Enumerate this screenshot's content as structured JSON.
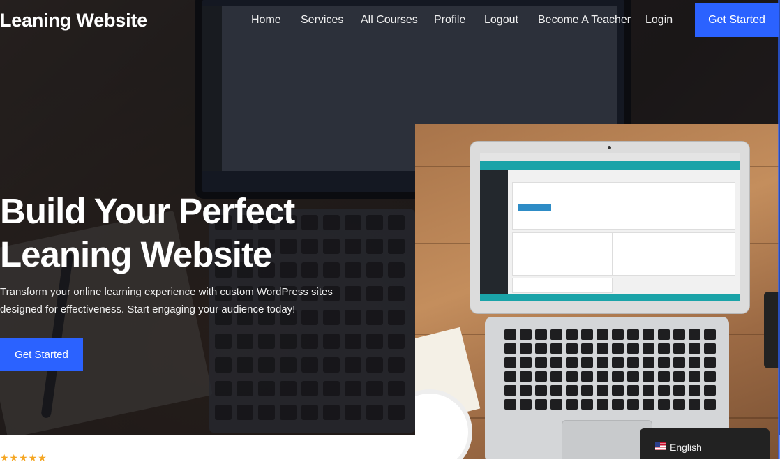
{
  "header": {
    "site_title": "Leaning Website",
    "nav": [
      "Home",
      "Services",
      "All Courses",
      "Profile",
      "Logout",
      "Become A Teacher",
      "Login"
    ],
    "cta_label": "Get Started"
  },
  "hero": {
    "title_line1": "Build Your Perfect",
    "title_line2": "Leaning Website",
    "subtitle_line1": "Transform your online learning experience with custom WordPress sites",
    "subtitle_line2": "designed for effectiveness. Start engaging your audience today!",
    "cta_label": "Get Started"
  },
  "rating": {
    "stars": "★★★★★"
  },
  "language_switcher": {
    "label": "English"
  },
  "colors": {
    "accent": "#2b62ff",
    "stars": "#f5a623",
    "badge_bg": "#222222"
  }
}
